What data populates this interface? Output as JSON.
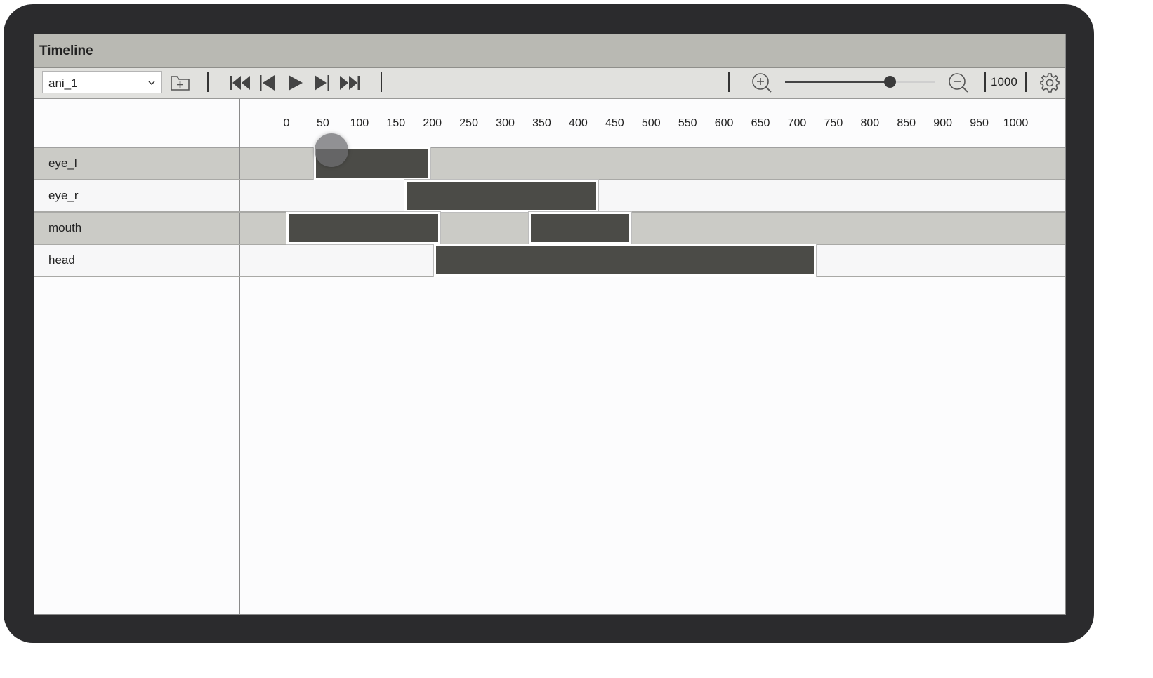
{
  "window": {
    "title": "Timeline"
  },
  "toolbar": {
    "animation_select": {
      "value": "ani_1"
    },
    "icons": {
      "add": "add-folder-icon",
      "first": "skip-to-start-icon",
      "prev": "step-back-icon",
      "play": "play-icon",
      "next": "step-forward-icon",
      "last": "skip-to-end-icon",
      "zoom_in": "zoom-in-icon",
      "zoom_out": "zoom-out-icon",
      "settings": "gear-icon"
    },
    "zoom_slider_level": 0.72,
    "zoom_value": "1000"
  },
  "ruler": {
    "ticks": [
      "0",
      "50",
      "100",
      "150",
      "200",
      "250",
      "300",
      "350",
      "400",
      "450",
      "500",
      "550",
      "600",
      "650",
      "700",
      "750",
      "800",
      "850",
      "900",
      "950",
      "1000"
    ]
  },
  "tracks": [
    {
      "name": "eye_l",
      "clips": [
        {
          "start": 40,
          "end": 195
        }
      ]
    },
    {
      "name": "eye_r",
      "clips": [
        {
          "start": 165,
          "end": 425
        }
      ]
    },
    {
      "name": "mouth",
      "clips": [
        {
          "start": 3,
          "end": 208
        },
        {
          "start": 335,
          "end": 470
        }
      ]
    },
    {
      "name": "head",
      "clips": [
        {
          "start": 205,
          "end": 723
        }
      ]
    }
  ],
  "playhead_time": 62,
  "colors": {
    "title_bar": "#b9b9b3",
    "toolbar": "#e1e1de",
    "clip": "#4b4b47",
    "row_shade": "#cbcbc6",
    "bezel": "#2b2b2d"
  }
}
